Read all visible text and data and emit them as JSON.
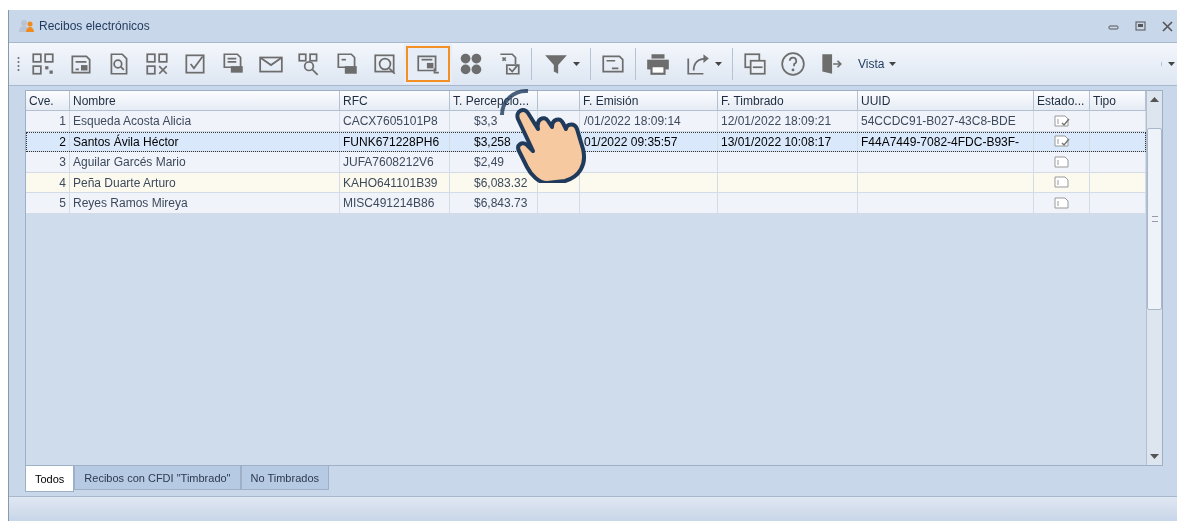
{
  "window": {
    "title": "Recibos electrónicos"
  },
  "toolbar": {
    "buttons": [
      {
        "highlighted": false
      },
      {
        "highlighted": false
      },
      {
        "highlighted": false
      },
      {
        "highlighted": false
      },
      {
        "highlighted": false
      },
      {
        "highlighted": false
      },
      {
        "highlighted": false
      },
      {
        "highlighted": false
      },
      {
        "highlighted": false
      },
      {
        "highlighted": false
      },
      {
        "highlighted": true
      },
      {
        "highlighted": false
      },
      {
        "highlighted": false
      },
      {
        "highlighted": false
      },
      {
        "highlighted": false
      },
      {
        "highlighted": false
      },
      {
        "highlighted": false
      },
      {
        "highlighted": false
      },
      {
        "highlighted": false
      },
      {
        "highlighted": false
      }
    ],
    "menu_label": "Vista"
  },
  "table": {
    "columns": [
      "Cve.",
      "Nombre",
      "RFC",
      "T. Percepcio...",
      "",
      "F. Emisión",
      "F. Timbrado",
      "UUID",
      "Estado...",
      "Tipo"
    ],
    "rows": [
      {
        "cve": "1",
        "nombre": "Esqueda Acosta Alicia",
        "rfc": "CACX7605101P8",
        "total": "$3,3",
        "emision": "/01/2022 18:09:14",
        "timbrado": "12/01/2022 18:09:21",
        "uuid": "54CCDC91-B027-43C8-BDE",
        "stamped": true,
        "selected": false
      },
      {
        "cve": "2",
        "nombre": "Santos Ávila Héctor",
        "rfc": "FUNK671228PH6",
        "total": "$3,258",
        "emision": "01/2022 09:35:57",
        "timbrado": "13/01/2022 10:08:17",
        "uuid": "F44A7449-7082-4FDC-B93F-",
        "stamped": true,
        "selected": true
      },
      {
        "cve": "3",
        "nombre": "Aguilar Garcés Mario",
        "rfc": "JUFA7608212V6",
        "total": "$2,49",
        "emision": "",
        "timbrado": "",
        "uuid": "",
        "stamped": false,
        "selected": false
      },
      {
        "cve": "4",
        "nombre": "Peña Duarte Arturo",
        "rfc": "KAHO641101B39",
        "total": "$6,083.32",
        "emision": "",
        "timbrado": "",
        "uuid": "",
        "stamped": false,
        "selected": false
      },
      {
        "cve": "5",
        "nombre": "Reyes Ramos Mireya",
        "rfc": "MISC491214B86",
        "total": "$6,843.73",
        "emision": "",
        "timbrado": "",
        "uuid": "",
        "stamped": false,
        "selected": false
      }
    ]
  },
  "tabs": [
    {
      "label": "Todos",
      "selected": true
    },
    {
      "label": "Recibos con CFDI \"Timbrado\"",
      "selected": false
    },
    {
      "label": "No Timbrados",
      "selected": false
    }
  ]
}
